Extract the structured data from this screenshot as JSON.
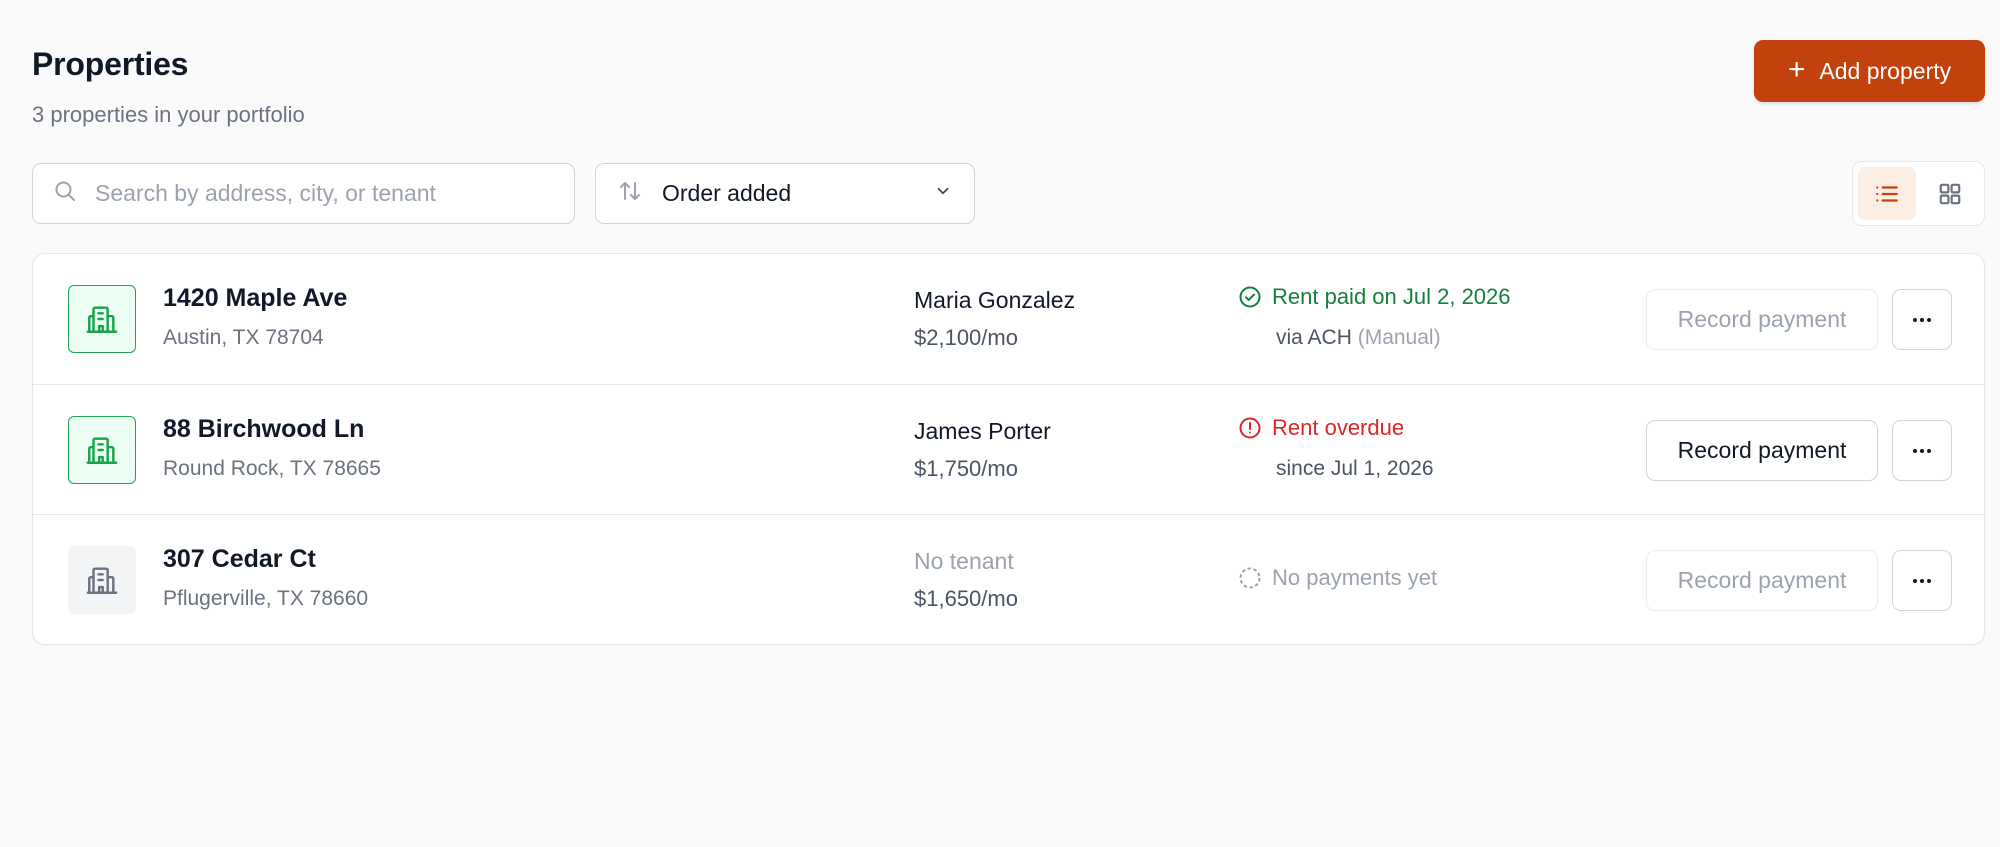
{
  "header": {
    "title": "Properties",
    "subtitle": "3 properties in your portfolio",
    "add_button_label": "Add property"
  },
  "toolbar": {
    "search_placeholder": "Search by address, city, or tenant",
    "search_value": "",
    "sort_label": "Order added",
    "view_mode": "list"
  },
  "colors": {
    "accent": "#c2410c",
    "paid": "#15803d",
    "overdue": "#dc2626",
    "muted": "#9ca3af"
  },
  "properties": [
    {
      "address": "1420 Maple Ave",
      "city": "Austin, TX 78704",
      "tenant": "Maria Gonzalez",
      "rent": "$2,100/mo",
      "status": "paid",
      "status_text": "Rent paid on Jul 2, 2026",
      "status_detail": "via ACH",
      "status_detail_muted": "(Manual)",
      "record_button_label": "Record payment",
      "record_button_enabled": false
    },
    {
      "address": "88 Birchwood Ln",
      "city": "Round Rock, TX 78665",
      "tenant": "James Porter",
      "rent": "$1,750/mo",
      "status": "overdue",
      "status_text": "Rent overdue",
      "status_detail": "since Jul 1, 2026",
      "record_button_label": "Record payment",
      "record_button_enabled": true
    },
    {
      "address": "307 Cedar Ct",
      "city": "Pflugerville, TX 78660",
      "tenant": "No tenant",
      "rent": "$1,650/mo",
      "status": "none",
      "status_text": "No payments yet",
      "record_button_label": "Record payment",
      "record_button_enabled": false
    }
  ]
}
